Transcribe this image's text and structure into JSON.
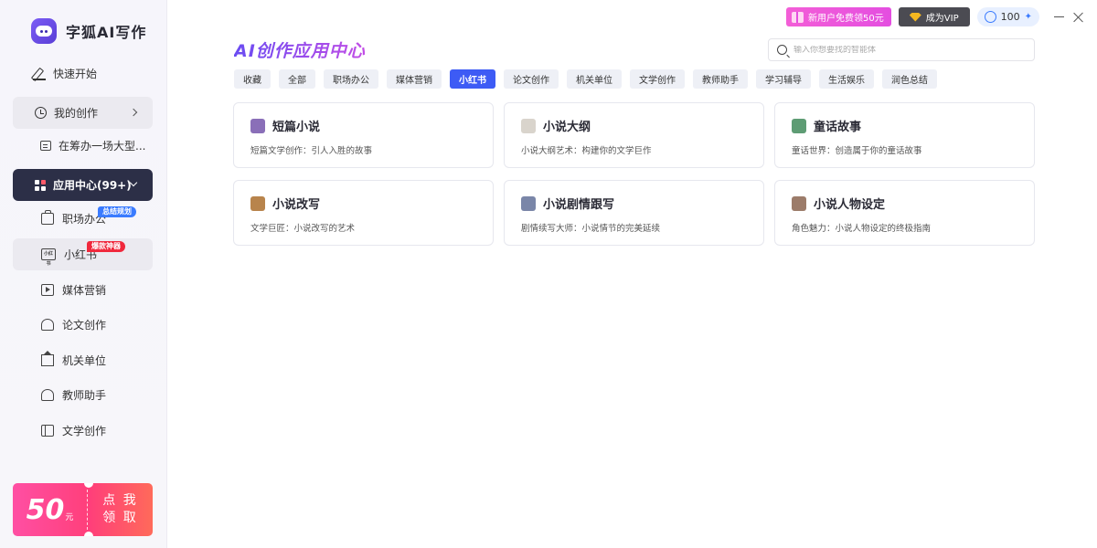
{
  "app": {
    "name": "字狐AI写作"
  },
  "sidebar": {
    "quick_start": "快速开始",
    "my_creations": "我的创作",
    "recent_item": "在筹办一场大型...",
    "app_center": "应用中心(99+)",
    "items": [
      {
        "label": "职场办公",
        "icon": "briefcase-icon"
      },
      {
        "label": "小红书",
        "icon": "xiaohongshu-icon",
        "icon_text": "小红书"
      },
      {
        "label": "媒体营销",
        "icon": "video-icon"
      },
      {
        "label": "论文创作",
        "icon": "graduation-cap-icon"
      },
      {
        "label": "机关单位",
        "icon": "government-building-icon"
      },
      {
        "label": "教师助手",
        "icon": "teacher-icon"
      },
      {
        "label": "文学创作",
        "icon": "book-icon"
      }
    ],
    "badges": {
      "office": "总结规划",
      "xiaohongshu": "爆款神器"
    },
    "promo": {
      "amount": "50",
      "unit": "元",
      "line1": "点 我",
      "line2": "领 取"
    }
  },
  "topbar": {
    "new_user": "新用户免费领50元",
    "vip": "成为VIP",
    "points": "100"
  },
  "main": {
    "title": "AI创作应用中心",
    "search_placeholder": "输入你想要找的智能体",
    "tabs": [
      "收藏",
      "全部",
      "职场办公",
      "媒体营销",
      "小红书",
      "论文创作",
      "机关单位",
      "文学创作",
      "教师助手",
      "学习辅导",
      "生活娱乐",
      "润色总结"
    ],
    "active_tab": "小红书",
    "cards": [
      {
        "title": "短篇小说",
        "desc": "短篇文学创作：引人入胜的故事",
        "thumb_color": "#8a6fb8"
      },
      {
        "title": "小说大纲",
        "desc": "小说大纲艺术：构建你的文学巨作",
        "thumb_color": "#d9d4cc"
      },
      {
        "title": "童话故事",
        "desc": "童话世界：创造属于你的童话故事",
        "thumb_color": "#5e9c74"
      },
      {
        "title": "小说改写",
        "desc": "文学巨匠：小说改写的艺术",
        "thumb_color": "#b8844c"
      },
      {
        "title": "小说剧情跟写",
        "desc": "剧情续写大师：小说情节的完美延续",
        "thumb_color": "#7a86a8"
      },
      {
        "title": "小说人物设定",
        "desc": "角色魅力：小说人物设定的终极指南",
        "thumb_color": "#9c7c6a"
      }
    ]
  }
}
